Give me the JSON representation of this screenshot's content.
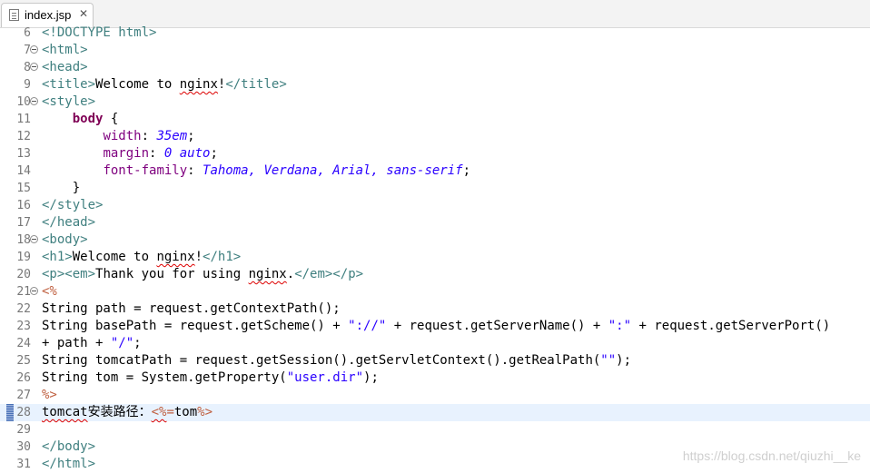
{
  "tab": {
    "file_name": "index.jsp",
    "close_glyph": "✕",
    "icon": "file-icon"
  },
  "lines": [
    {
      "n": "6",
      "fold": false,
      "tokens": [
        [
          "tag",
          "<!DOCTYPE html>"
        ]
      ]
    },
    {
      "n": "7",
      "fold": true,
      "tokens": [
        [
          "tag",
          "<html>"
        ]
      ]
    },
    {
      "n": "8",
      "fold": true,
      "tokens": [
        [
          "tag",
          "<head>"
        ]
      ]
    },
    {
      "n": "9",
      "fold": false,
      "tokens": [
        [
          "tag",
          "<title>"
        ],
        [
          "plain",
          "Welcome to "
        ],
        [
          "wavy",
          "nginx"
        ],
        [
          "plain",
          "!"
        ],
        [
          "tag",
          "</title>"
        ]
      ]
    },
    {
      "n": "10",
      "fold": true,
      "tokens": [
        [
          "tag",
          "<style>"
        ]
      ]
    },
    {
      "n": "11",
      "fold": false,
      "tokens": [
        [
          "plain",
          "    "
        ],
        [
          "kw",
          "body"
        ],
        [
          "plain",
          " {"
        ]
      ]
    },
    {
      "n": "12",
      "fold": false,
      "tokens": [
        [
          "plain",
          "        "
        ],
        [
          "prop",
          "width"
        ],
        [
          "plain",
          ": "
        ],
        [
          "val",
          "35em"
        ],
        [
          "plain",
          ";"
        ]
      ]
    },
    {
      "n": "13",
      "fold": false,
      "tokens": [
        [
          "plain",
          "        "
        ],
        [
          "prop",
          "margin"
        ],
        [
          "plain",
          ": "
        ],
        [
          "val",
          "0 auto"
        ],
        [
          "plain",
          ";"
        ]
      ]
    },
    {
      "n": "14",
      "fold": false,
      "tokens": [
        [
          "plain",
          "        "
        ],
        [
          "prop",
          "font-family"
        ],
        [
          "plain",
          ": "
        ],
        [
          "val",
          "Tahoma, Verdana, Arial, sans-serif"
        ],
        [
          "plain",
          ";"
        ]
      ]
    },
    {
      "n": "15",
      "fold": false,
      "tokens": [
        [
          "plain",
          "    }"
        ]
      ]
    },
    {
      "n": "16",
      "fold": false,
      "tokens": [
        [
          "tag",
          "</style>"
        ]
      ]
    },
    {
      "n": "17",
      "fold": false,
      "tokens": [
        [
          "tag",
          "</head>"
        ]
      ]
    },
    {
      "n": "18",
      "fold": true,
      "tokens": [
        [
          "tag",
          "<body>"
        ]
      ]
    },
    {
      "n": "19",
      "fold": false,
      "tokens": [
        [
          "tag",
          "<h1>"
        ],
        [
          "plain",
          "Welcome to "
        ],
        [
          "wavy",
          "nginx"
        ],
        [
          "plain",
          "!"
        ],
        [
          "tag",
          "</h1>"
        ]
      ]
    },
    {
      "n": "20",
      "fold": false,
      "tokens": [
        [
          "tag",
          "<p><em>"
        ],
        [
          "plain",
          "Thank you for using "
        ],
        [
          "wavy",
          "nginx"
        ],
        [
          "plain",
          "."
        ],
        [
          "tag",
          "</em></p>"
        ]
      ]
    },
    {
      "n": "21",
      "fold": true,
      "tokens": [
        [
          "jsp",
          "<%"
        ]
      ]
    },
    {
      "n": "22",
      "fold": false,
      "tokens": [
        [
          "plain",
          "String path = request.getContextPath();"
        ]
      ]
    },
    {
      "n": "23",
      "fold": false,
      "tokens": [
        [
          "plain",
          "String basePath = request.getScheme() + "
        ],
        [
          "str",
          "\"://\""
        ],
        [
          "plain",
          " + request.getServerName() + "
        ],
        [
          "str",
          "\":\""
        ],
        [
          "plain",
          " + request.getServerPort()"
        ]
      ]
    },
    {
      "n": "24",
      "fold": false,
      "tokens": [
        [
          "plain",
          "+ path + "
        ],
        [
          "str",
          "\"/\""
        ],
        [
          "plain",
          ";"
        ]
      ]
    },
    {
      "n": "25",
      "fold": false,
      "tokens": [
        [
          "plain",
          "String tomcatPath = request.getSession().getServletContext().getRealPath("
        ],
        [
          "str",
          "\"\""
        ],
        [
          "plain",
          ");"
        ]
      ]
    },
    {
      "n": "26",
      "fold": false,
      "tokens": [
        [
          "plain",
          "String tom = System.getProperty("
        ],
        [
          "str",
          "\"user.dir\""
        ],
        [
          "plain",
          ");"
        ]
      ]
    },
    {
      "n": "27",
      "fold": false,
      "tokens": [
        [
          "jsp",
          "%>"
        ]
      ]
    },
    {
      "n": "28",
      "fold": false,
      "current": true,
      "tokens": [
        [
          "wavy",
          "tomcat"
        ],
        [
          "cjk",
          "安装路径："
        ],
        [
          "jspwavy",
          "<%"
        ],
        [
          "jsp",
          "="
        ],
        [
          "plain",
          "tom"
        ],
        [
          "jsp",
          "%>"
        ]
      ]
    },
    {
      "n": "29",
      "fold": false,
      "tokens": []
    },
    {
      "n": "30",
      "fold": false,
      "tokens": [
        [
          "tag",
          "</body>"
        ]
      ]
    },
    {
      "n": "31",
      "fold": false,
      "tokens": [
        [
          "tag",
          "</html>"
        ]
      ]
    }
  ],
  "watermark": "https://blog.csdn.net/qiuzhi__ke"
}
